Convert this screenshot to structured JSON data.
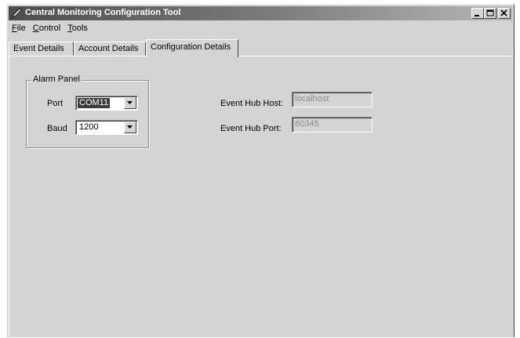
{
  "window": {
    "title": "Central Monitoring Configuration Tool",
    "minimize_glyph": "_",
    "maximize_glyph": "□",
    "close_glyph": "×"
  },
  "menu": [
    {
      "label": "File",
      "accel": "F",
      "rest": "ile"
    },
    {
      "label": "Control",
      "accel": "C",
      "rest": "ontrol"
    },
    {
      "label": "Tools",
      "accel": "T",
      "rest": "ools"
    }
  ],
  "tabs": [
    {
      "label": "Event Details",
      "active": false
    },
    {
      "label": "Account Details",
      "active": false
    },
    {
      "label": "Configuration Details",
      "active": true
    }
  ],
  "alarm_panel": {
    "legend": "Alarm Panel",
    "port_label": "Port",
    "port_value": "COM11",
    "baud_label": "Baud",
    "baud_value": "1200"
  },
  "event_hub": {
    "host_label": "Event Hub Host:",
    "host_value": "localhost",
    "port_label": "Event Hub Port:",
    "port_value": "60345"
  }
}
